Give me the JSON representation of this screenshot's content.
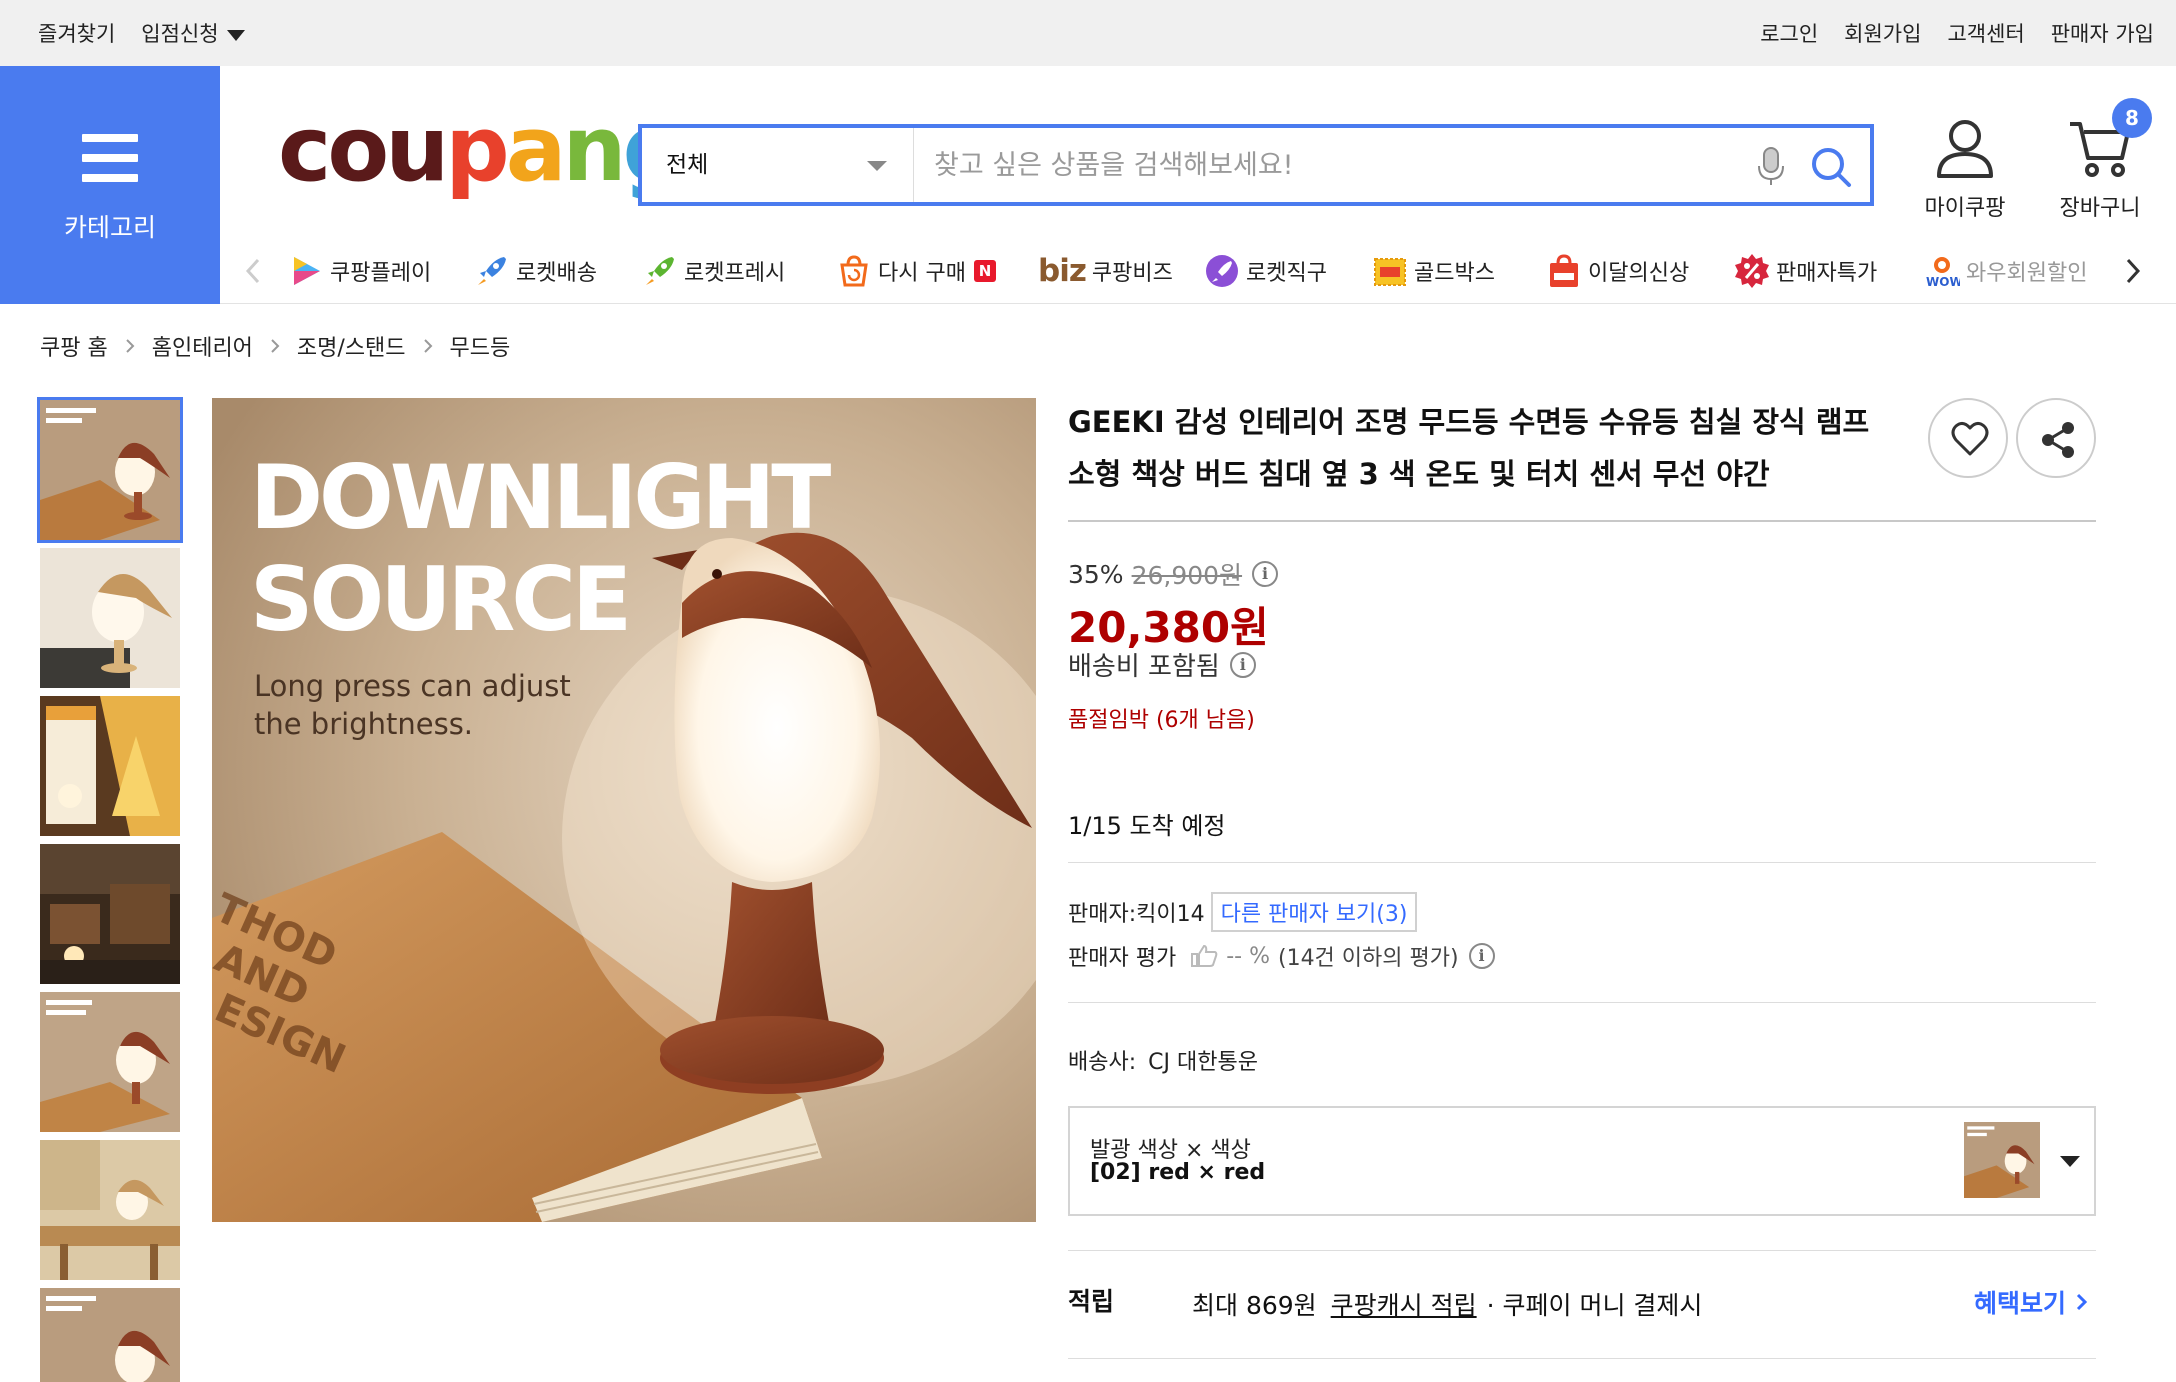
{
  "topbar": {
    "bookmark": "즐겨찾기",
    "apply": "입점신청",
    "login": "로그인",
    "signup": "회원가입",
    "support": "고객센터",
    "seller_join": "판매자 가입"
  },
  "header": {
    "category_label": "카테고리",
    "logo": [
      "c",
      "o",
      "u",
      "p",
      "a",
      "n",
      "g"
    ],
    "logo_colors": [
      "#5a1a1a",
      "#5a1a1a",
      "#5a1a1a",
      "#e8412c",
      "#f2a41b",
      "#79b83c",
      "#3fa2d8"
    ],
    "search_scope": "전체",
    "search_placeholder": "찾고 싶은 상품을 검색해보세요!",
    "mycoupang": "마이쿠팡",
    "cart": "장바구니",
    "cart_count": "8",
    "accent": "#4a7bef"
  },
  "nav": {
    "items": [
      {
        "label": "쿠팡플레이",
        "icon": "play-icon"
      },
      {
        "label": "로켓배송",
        "icon": "rocket-icon"
      },
      {
        "label": "로켓프레시",
        "icon": "rocket-fresh-icon"
      },
      {
        "label": "다시 구매",
        "icon": "rebuy-icon",
        "badge": "N"
      },
      {
        "label": "쿠팡비즈",
        "icon": "biz-logo",
        "prefix": "biz"
      },
      {
        "label": "로켓직구",
        "icon": "rocket-global-icon"
      },
      {
        "label": "골드박스",
        "icon": "goldbox-icon"
      },
      {
        "label": "이달의신상",
        "icon": "new-bag-icon"
      },
      {
        "label": "판매자특가",
        "icon": "percent-icon"
      },
      {
        "label": "와우회원할인",
        "icon": "wow-icon"
      }
    ]
  },
  "breadcrumb": [
    "쿠팡 홈",
    "홈인테리어",
    "조명/스탠드",
    "무드등"
  ],
  "product": {
    "image_text": {
      "line1": "DOWNLIGHT",
      "line2": "SOURCE",
      "line3": "Long press can adjust",
      "line4": "the brightness.",
      "book1": "THOD",
      "book2": "AND",
      "book3": "ESIGN"
    },
    "title_line1": "GEEKI 감성 인테리어 조명 무드등 수면등 수유등 침실 장식 램프",
    "title_line2": "소형 책상 버드 침대 옆 3 색 온도 및 터치 센서 무선 야간",
    "discount_rate": "35%",
    "original_price": "26,900원",
    "price": "20,380원",
    "shipping": "배송비 포함됨",
    "stock": "품절임박 (6개 남음)",
    "arrival_date": "1/15",
    "arrival_text": "도착 예정",
    "seller_label": "판매자:",
    "seller_name": "킥이14",
    "other_sellers": "다른 판매자 보기(3)",
    "rating_label": "판매자 평가",
    "rating_value": "-- %",
    "rating_note": "(14건 이하의 평가)",
    "carrier_label": "배송사:",
    "carrier": "CJ 대한통운",
    "option_name": "발광 색상 × 색상",
    "option_value": "[02] red × red",
    "cash_label": "적립",
    "cash_amount": "최대 869원",
    "cash_link": "쿠팡캐시 적립",
    "cash_cond": "· 쿠페이 머니 결제시",
    "cash_more": "혜택보기",
    "price_color": "#ae0000",
    "link_color": "#346aff"
  }
}
